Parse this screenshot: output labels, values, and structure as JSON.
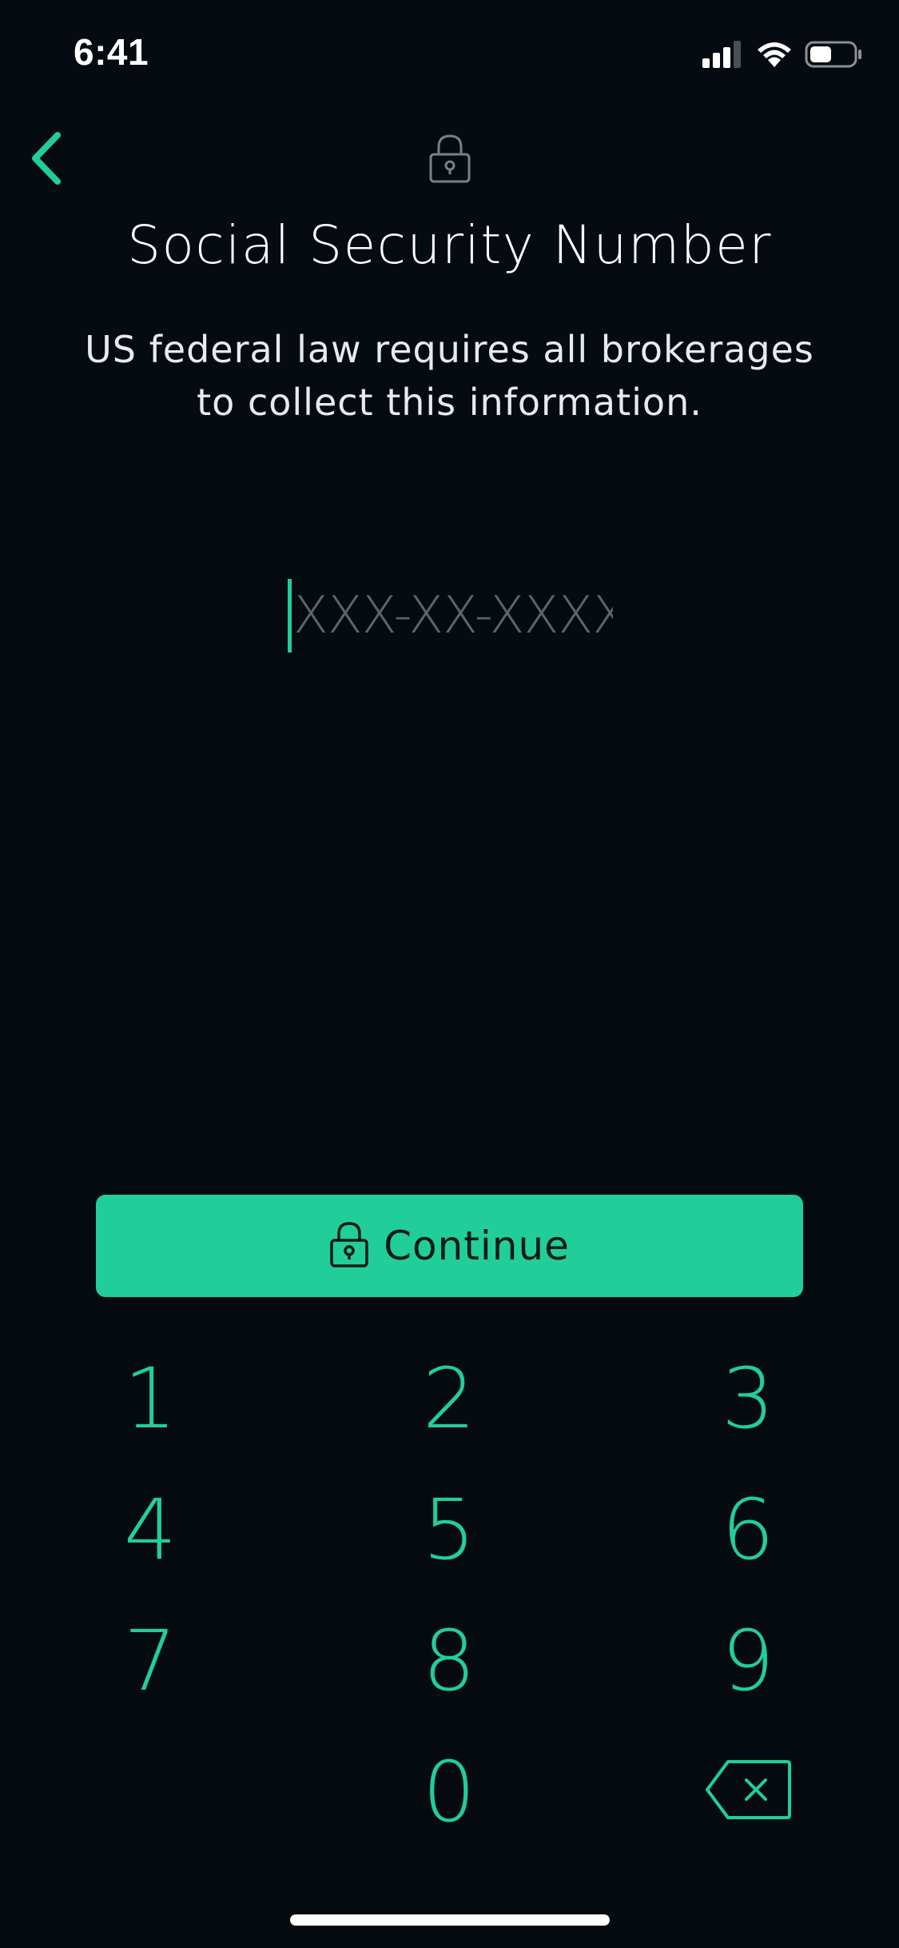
{
  "status_bar": {
    "time": "6:41",
    "signal_icon": "cellular-signal-icon",
    "wifi_icon": "wifi-icon",
    "battery_icon": "battery-icon"
  },
  "nav": {
    "back_icon": "chevron-left-icon",
    "lock_icon": "padlock-icon"
  },
  "title": "Social Security Number",
  "subtitle": "US federal law requires all brokerages to collect this information.",
  "ssn_input": {
    "value": "",
    "placeholder": "XXX-XX-XXXX"
  },
  "continue_button": {
    "label": "Continue",
    "icon": "padlock-icon"
  },
  "keypad": {
    "keys": [
      "1",
      "2",
      "3",
      "4",
      "5",
      "6",
      "7",
      "8",
      "9",
      "0"
    ],
    "backspace_icon": "backspace-icon"
  },
  "colors": {
    "background": "#060b12",
    "accent": "#21ce99",
    "placeholder": "#5d646c",
    "text": "#ffffff"
  }
}
